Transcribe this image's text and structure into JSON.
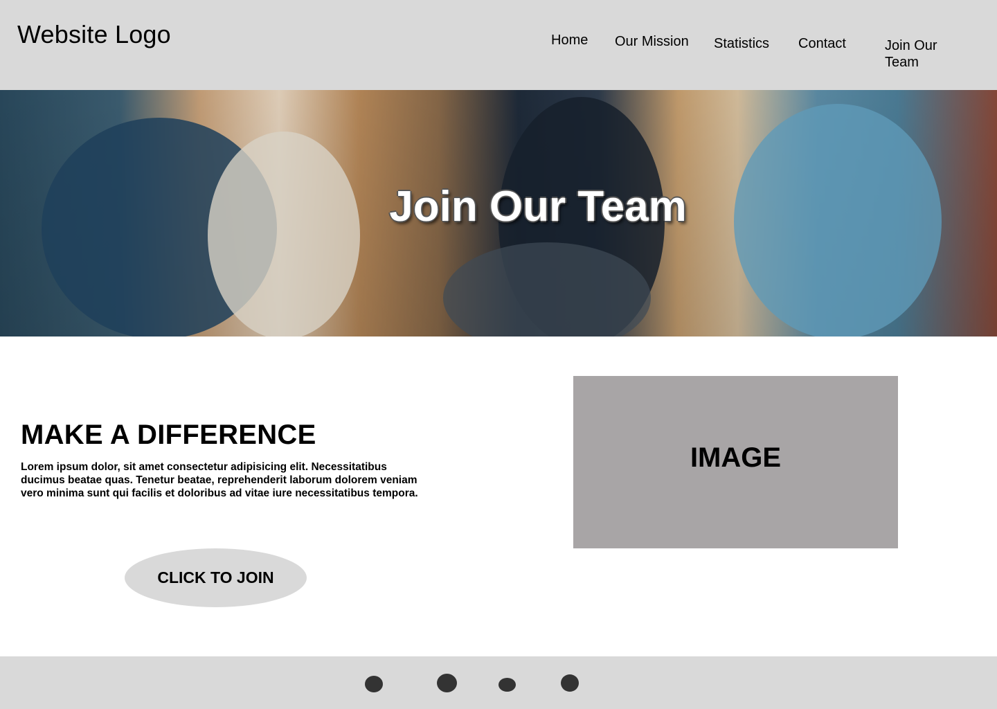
{
  "header": {
    "logo": "Website Logo",
    "nav": [
      {
        "label": "Home"
      },
      {
        "label": "Our Mission"
      },
      {
        "label": "Statistics"
      },
      {
        "label": "Contact"
      },
      {
        "label": "Join Our Team"
      }
    ]
  },
  "hero": {
    "title": "Join Our Team"
  },
  "main": {
    "heading": "MAKE A DIFFERENCE",
    "body": "Lorem ipsum dolor, sit amet consectetur adipisicing elit. Necessitatibus ducimus beatae quas. Tenetur beatae, reprehenderit laborum dolorem veniam vero minima sunt qui facilis et doloribus ad vitae iure necessitatibus tempora.",
    "button_label": "CLICK TO JOIN",
    "image_label": "IMAGE"
  },
  "footer": {
    "social_icons": [
      "social-icon-1",
      "social-icon-2",
      "social-icon-3",
      "social-icon-4"
    ]
  },
  "colors": {
    "header_bg": "#d9d9d9",
    "footer_bg": "#d9d9d9",
    "button_bg": "#d9d9d9",
    "image_placeholder_bg": "#a8a5a6",
    "icon_color": "#333333"
  }
}
